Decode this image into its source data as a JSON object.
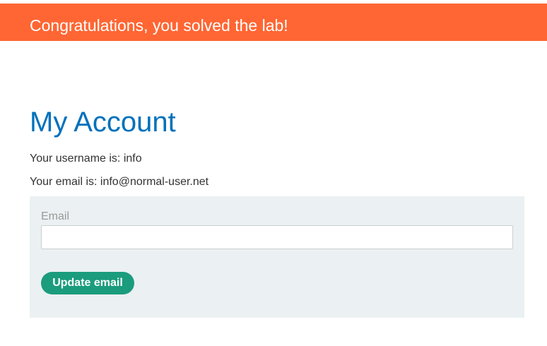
{
  "banner": {
    "message": "Congratulations, you solved the lab!",
    "color": "#ff6633"
  },
  "account": {
    "title": "My Account",
    "username_text": "Your username is: info",
    "email_text": "Your email is: info@normal-user.net"
  },
  "form": {
    "email_label": "Email",
    "email_value": "",
    "email_placeholder": "",
    "submit_label": "Update email",
    "button_color": "#1a9c7d",
    "panel_color": "#ebf0f2"
  },
  "colors": {
    "title": "#0071bc",
    "text": "#333332"
  }
}
